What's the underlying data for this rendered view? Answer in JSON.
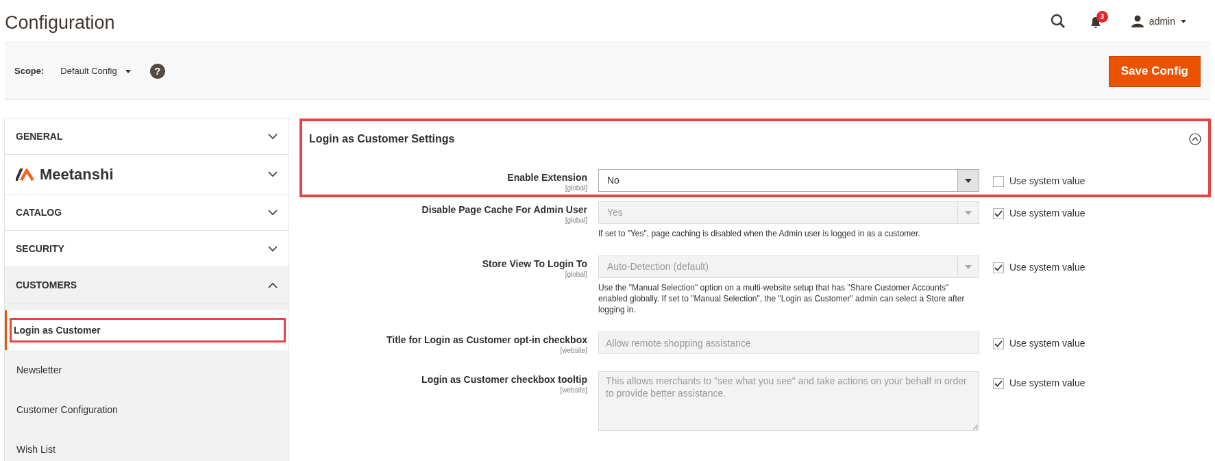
{
  "header": {
    "title": "Configuration",
    "notifications_count": "3",
    "user": "admin"
  },
  "scope_bar": {
    "label": "Scope:",
    "value": "Default Config",
    "help": "?",
    "save_button": "Save Config"
  },
  "sidebar": {
    "sections": [
      {
        "label": "GENERAL",
        "kind": "text",
        "expanded": false
      },
      {
        "label": "Meetanshi",
        "kind": "logo",
        "expanded": false
      },
      {
        "label": "CATALOG",
        "kind": "text",
        "expanded": false
      },
      {
        "label": "SECURITY",
        "kind": "text",
        "expanded": false
      },
      {
        "label": "CUSTOMERS",
        "kind": "text",
        "expanded": true,
        "children": [
          {
            "label": "Login as Customer",
            "selected": true,
            "highlighted": true
          },
          {
            "label": "Newsletter",
            "selected": false,
            "highlighted": false
          },
          {
            "label": "Customer Configuration",
            "selected": false,
            "highlighted": false
          },
          {
            "label": "Wish List",
            "selected": false,
            "highlighted": false
          }
        ]
      }
    ]
  },
  "section": {
    "title": "Login as Customer Settings",
    "expanded": true,
    "highlighted": true,
    "fields": [
      {
        "label": "Enable Extension",
        "scope": "[global]",
        "kind": "select",
        "value": "No",
        "disabled": false,
        "use_system_value": "Use system value",
        "checked": false
      },
      {
        "label": "Disable Page Cache For Admin User",
        "scope": "[global]",
        "kind": "select",
        "value": "Yes",
        "disabled": true,
        "use_system_value": "Use system value",
        "checked": true,
        "note": "If set to \"Yes\", page caching is disabled when the Admin user is logged in as a customer."
      },
      {
        "label": "Store View To Login To",
        "scope": "[global]",
        "kind": "select",
        "value": "Auto-Detection (default)",
        "disabled": true,
        "use_system_value": "Use system value",
        "checked": true,
        "note": "Use the \"Manual Selection\" option on a multi-website setup that has \"Share Customer Accounts\" enabled globally. If set to \"Manual Selection\", the \"Login as Customer\" admin can select a Store after logging in."
      },
      {
        "label": "Title for Login as Customer opt-in checkbox",
        "scope": "[website]",
        "kind": "text",
        "value": "Allow remote shopping assistance",
        "disabled": true,
        "use_system_value": "Use system value",
        "checked": true
      },
      {
        "label": "Login as Customer checkbox tooltip",
        "scope": "[website]",
        "kind": "textarea",
        "value": "This allows merchants to \"see what you see\" and take actions on your behalf in order to provide better assistance.",
        "disabled": true,
        "use_system_value": "Use system value",
        "checked": true
      }
    ]
  }
}
